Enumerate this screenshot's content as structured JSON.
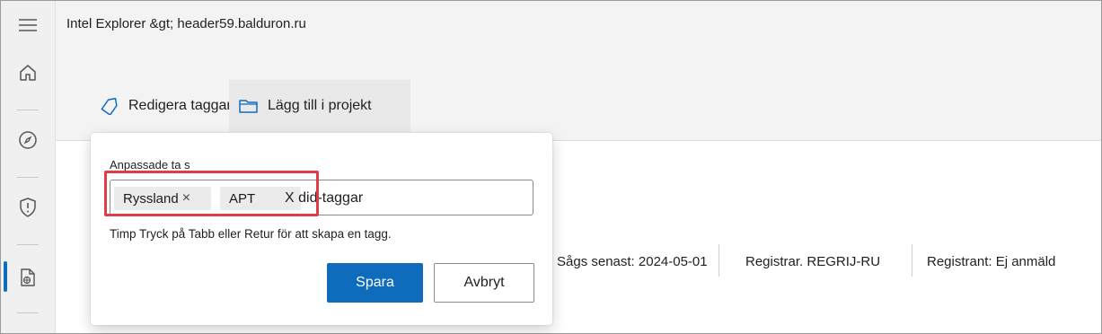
{
  "breadcrumb": "Intel Explorer &gt; header59.balduron.ru",
  "commands": {
    "edit_tags": "Redigera taggar",
    "add_to_project": "Lägg till i projekt"
  },
  "info": {
    "last_seen": "Sågs senast: 2024-05-01",
    "registrar": "Registrar. REGRIJ-RU",
    "registrant": "Registrant: Ej anmäld"
  },
  "popup": {
    "label": "Anpassade ta s",
    "tags": [
      {
        "label": "Ryssland",
        "remove": "×"
      },
      {
        "label": "APT"
      }
    ],
    "typed_text": "X did-taggar",
    "hint": "Timp Tryck på Tabb eller Retur för att skapa en tagg.",
    "save_label": "Spara",
    "cancel_label": "Avbryt"
  },
  "colors": {
    "accent": "#0f6cbd",
    "highlight": "#e03c47"
  },
  "icons": {
    "rail": [
      "menu-icon",
      "home-icon",
      "compass-icon",
      "shield-alert-icon",
      "document-globe-icon"
    ],
    "edit_tags": "tag-icon",
    "add_to_project": "folder-icon"
  }
}
